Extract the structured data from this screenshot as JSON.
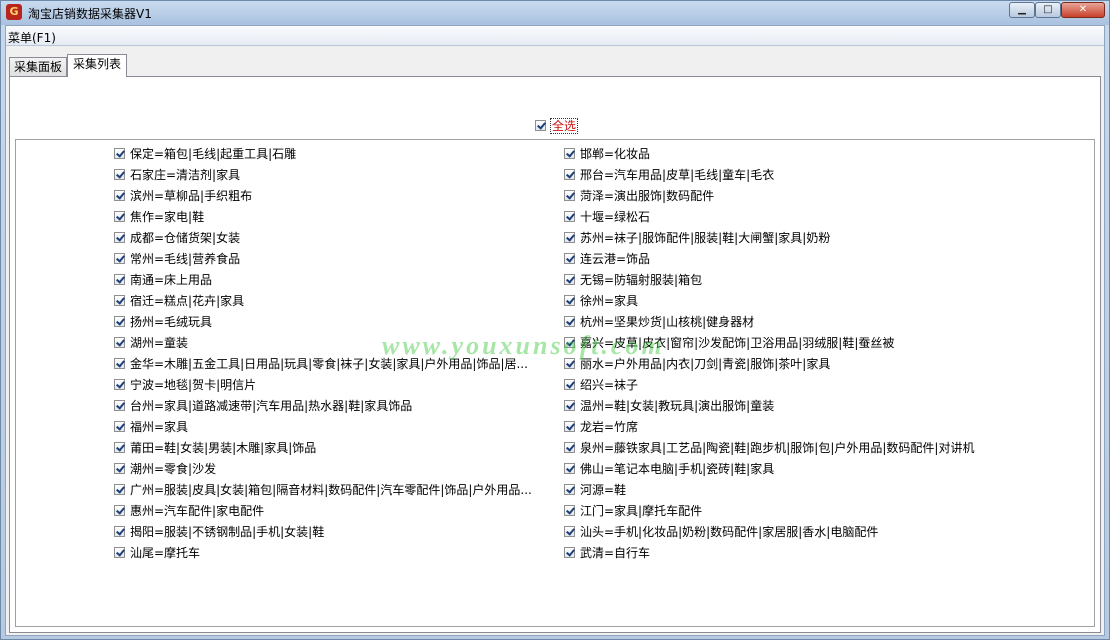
{
  "window": {
    "title": "淘宝店销数据采集器V1"
  },
  "menu": {
    "label": "菜单(F1)"
  },
  "tabs": [
    {
      "label": "采集面板"
    },
    {
      "label": "采集列表"
    }
  ],
  "select_all": {
    "label": "全选",
    "checked": true
  },
  "watermark": {
    "text": "www.youxunsoft.com"
  },
  "left_items": [
    "保定=箱包|毛线|起重工具|石雕",
    "石家庄=清洁剂|家具",
    "滨州=草柳品|手织粗布",
    "焦作=家电|鞋",
    "成都=仓储货架|女装",
    "常州=毛线|营养食品",
    "南通=床上用品",
    "宿迁=糕点|花卉|家具",
    "扬州=毛绒玩具",
    "湖州=童装",
    "金华=木雕|五金工具|日用品|玩具|零食|袜子|女装|家具|户外用品|饰品|居...",
    "宁波=地毯|贺卡|明信片",
    "台州=家具|道路减速带|汽车用品|热水器|鞋|家具饰品",
    "福州=家具",
    "莆田=鞋|女装|男装|木雕|家具|饰品",
    "潮州=零食|沙发",
    "广州=服装|皮具|女装|箱包|隔音材料|数码配件|汽车零配件|饰品|户外用品...",
    "惠州=汽车配件|家电配件",
    "揭阳=服装|不锈钢制品|手机|女装|鞋",
    "汕尾=摩托车"
  ],
  "right_items": [
    "邯郸=化妆品",
    "邢台=汽车用品|皮草|毛线|童车|毛衣",
    "菏泽=演出服饰|数码配件",
    "十堰=绿松石",
    "苏州=袜子|服饰配件|服装|鞋|大闸蟹|家具|奶粉",
    "连云港=饰品",
    "无锡=防辐射服装|箱包",
    "徐州=家具",
    "杭州=坚果炒货|山核桃|健身器材",
    "嘉兴=皮草|皮衣|窗帘|沙发配饰|卫浴用品|羽绒服|鞋|蚕丝被",
    "丽水=户外用品|内衣|刀剑|青瓷|服饰|茶叶|家具",
    "绍兴=袜子",
    "温州=鞋|女装|教玩具|演出服饰|童装",
    "龙岩=竹席",
    "泉州=藤铁家具|工艺品|陶瓷|鞋|跑步机|服饰|包|户外用品|数码配件|对讲机",
    "佛山=笔记本电脑|手机|瓷砖|鞋|家具",
    "河源=鞋",
    "江门=家具|摩托车配件",
    "汕头=手机|化妆品|奶粉|数码配件|家居服|香水|电脑配件",
    "武清=自行车"
  ]
}
